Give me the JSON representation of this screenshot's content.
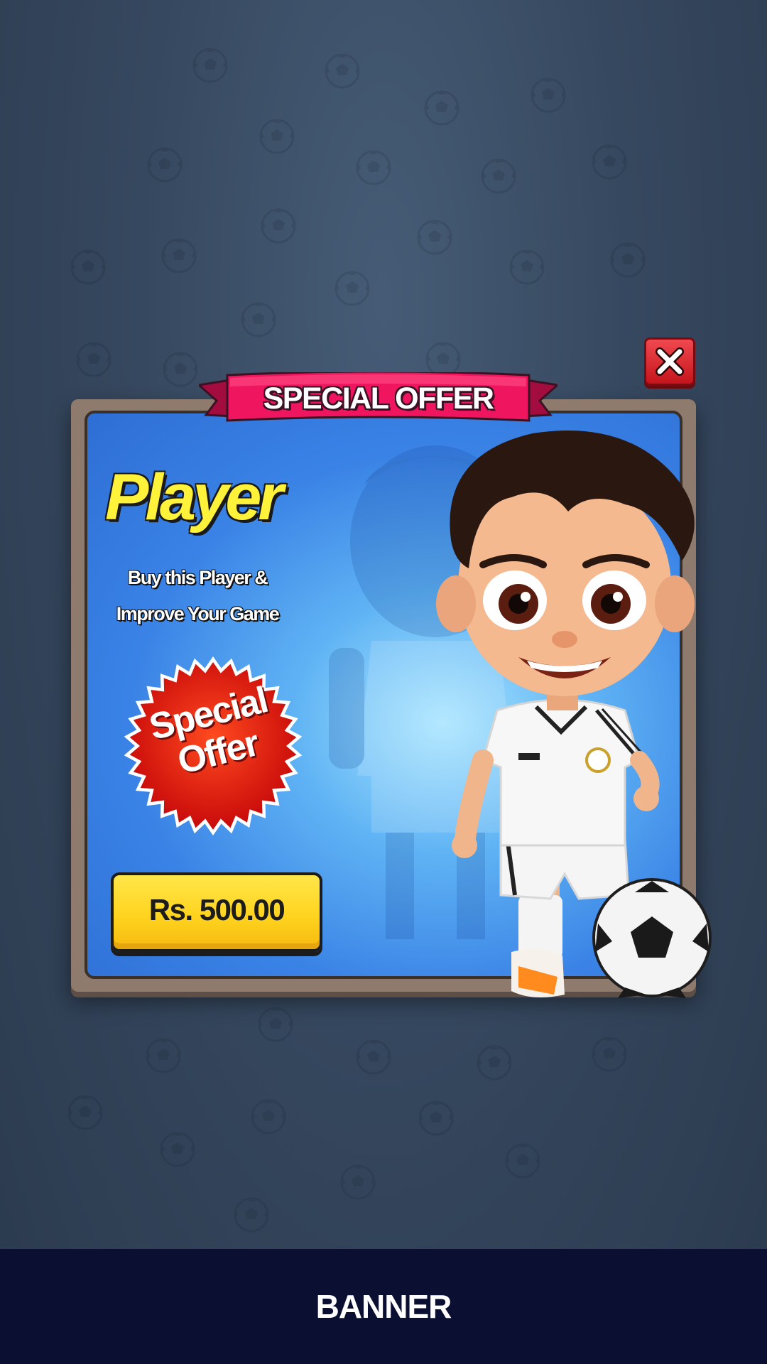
{
  "dialog": {
    "ribbon_title": "SPECIAL OFFER",
    "item_name": "Player",
    "description_line1": "Buy this Player &",
    "description_line2": "Improve Your Game",
    "badge_line1": "Special",
    "badge_line2": "Offer",
    "price": "Rs. 500.00"
  },
  "footer": {
    "label": "BANNER"
  },
  "icons": {
    "close": "close-icon",
    "background": "soccer-ball-icon",
    "ball": "soccer-ball"
  },
  "colors": {
    "ribbon": "#f0155f",
    "close_button": "#e0262e",
    "title_yellow": "#fff23a",
    "price_button": "#ffd41f",
    "badge_red": "#e4120f",
    "panel_blue": "#3a83e6",
    "footer": "#0b1033"
  }
}
